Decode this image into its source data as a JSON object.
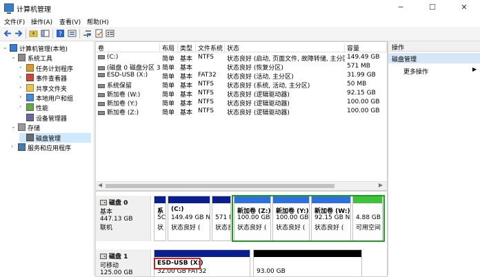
{
  "window": {
    "title": "计算机管理",
    "minimize": "─",
    "maximize": "☐",
    "close": "✕"
  },
  "menu": [
    "文件(F)",
    "操作(A)",
    "查看(V)",
    "帮助(H)"
  ],
  "tree": [
    {
      "label": "计算机管理(本地)",
      "indent": 0,
      "arrow": "⌄",
      "icon": "computer-icon"
    },
    {
      "label": "系统工具",
      "indent": 1,
      "arrow": "⌄",
      "icon": "tools-icon"
    },
    {
      "label": "任务计划程序",
      "indent": 2,
      "arrow": "›",
      "icon": "clock-icon"
    },
    {
      "label": "事件查看器",
      "indent": 2,
      "arrow": "›",
      "icon": "event-icon"
    },
    {
      "label": "共享文件夹",
      "indent": 2,
      "arrow": "›",
      "icon": "folder-icon"
    },
    {
      "label": "本地用户和组",
      "indent": 2,
      "arrow": "›",
      "icon": "users-icon"
    },
    {
      "label": "性能",
      "indent": 2,
      "arrow": "›",
      "icon": "performance-icon"
    },
    {
      "label": "设备管理器",
      "indent": 2,
      "arrow": "",
      "icon": "device-icon"
    },
    {
      "label": "存储",
      "indent": 1,
      "arrow": "⌄",
      "icon": "storage-icon"
    },
    {
      "label": "磁盘管理",
      "indent": 2,
      "arrow": "",
      "icon": "disk-icon",
      "selected": true
    },
    {
      "label": "服务和应用程序",
      "indent": 1,
      "arrow": "›",
      "icon": "services-icon"
    }
  ],
  "volumes": {
    "headers": [
      "卷",
      "布局",
      "类型",
      "文件系统",
      "状态",
      "容量"
    ],
    "rows": [
      [
        "(C:)",
        "简单",
        "基本",
        "NTFS",
        "状态良好 (启动, 页面文件, 故障转储, 主分区)",
        "149.49 GB"
      ],
      [
        "(磁盘 0 磁盘分区 3)",
        "简单",
        "基本",
        "",
        "状态良好 (恢复分区)",
        "571 MB"
      ],
      [
        "ESD-USB (X:)",
        "简单",
        "基本",
        "FAT32",
        "状态良好 (活动, 主分区)",
        "31.99 GB"
      ],
      [
        "系统保留",
        "简单",
        "基本",
        "NTFS",
        "状态良好 (系统, 活动, 主分区)",
        "50 MB"
      ],
      [
        "新加卷 (W:)",
        "简单",
        "基本",
        "NTFS",
        "状态良好 (逻辑驱动器)",
        "92.15 GB"
      ],
      [
        "新加卷 (Y:)",
        "简单",
        "基本",
        "NTFS",
        "状态良好 (逻辑驱动器)",
        "100.00 GB"
      ],
      [
        "新加卷 (Z:)",
        "简单",
        "基本",
        "NTFS",
        "状态良好 (逻辑驱动器)",
        "100.00 GB"
      ]
    ]
  },
  "disks": [
    {
      "name": "磁盘 0",
      "type": "基本",
      "size": "447.13 GB",
      "status": "联机",
      "partitions": [
        {
          "line1": "系",
          "line2": "5C",
          "line3": "状"
        },
        {
          "line1": "(C:)",
          "line2": "149.49 GB N",
          "line3": "状态良好 ("
        },
        {
          "line1": "",
          "line2": "571 M",
          "line3": "状态良"
        },
        {
          "line1": "新加卷 (Z:)",
          "line2": "100.00 GB",
          "line3": "状态良好 ("
        },
        {
          "line1": "新加卷 (Y:)",
          "line2": "100.00 GB",
          "line3": "状态良好 ("
        },
        {
          "line1": "新加卷 (W:)",
          "line2": "92.15 GB N",
          "line3": "状态良好 ("
        },
        {
          "line1": "",
          "line2": "4.88 GB",
          "line3": "可用空间"
        }
      ]
    },
    {
      "name": "磁盘 1",
      "type": "可移动",
      "size": "125.00 GB",
      "status": "",
      "partitions": [
        {
          "line1": "ESD-USB (X:)",
          "line2": "32.00 GB FAT32",
          "line3": ""
        },
        {
          "line1": "",
          "line2": "93.00 GB",
          "line3": ""
        }
      ]
    }
  ],
  "actions": {
    "header": "操作",
    "selected": "磁盘管理",
    "more": "更多操作",
    "more_arrow": "▶"
  },
  "colors": {
    "primary_partition": "#0a1f8f",
    "logical_partition": "#2f6fe0",
    "free_space": "#3ec23e",
    "selection": "#cde8ff",
    "highlight_green": "#1a9f1a",
    "highlight_red": "#d01c1c"
  }
}
